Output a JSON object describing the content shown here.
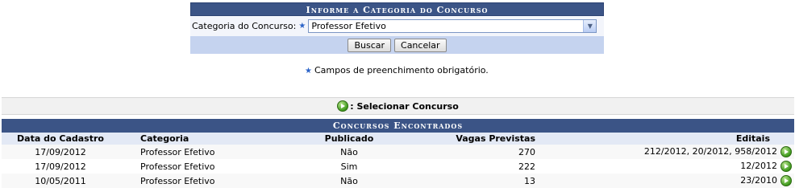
{
  "form": {
    "header": "Informe a Categoria do Concurso",
    "category_label": "Categoria do Concurso:",
    "category_value": "Professor Efetivo",
    "search_button": "Buscar",
    "cancel_button": "Cancelar"
  },
  "required_note": "Campos de preenchimento obrigatório.",
  "legend": {
    "icon": "go-arrow-icon",
    "label": ": Selecionar Concurso"
  },
  "results": {
    "caption": "Concursos Encontrados",
    "columns": [
      "Data do Cadastro",
      "Categoria",
      "Publicado",
      "Vagas Previstas",
      "Editais"
    ],
    "rows": [
      {
        "date": "17/09/2012",
        "category": "Professor Efetivo",
        "published": "Não",
        "vacancies": "270",
        "notices": "212/2012, 20/2012, 958/2012"
      },
      {
        "date": "17/09/2012",
        "category": "Professor Efetivo",
        "published": "Sim",
        "vacancies": "222",
        "notices": "12/2012"
      },
      {
        "date": "10/05/2011",
        "category": "Professor Efetivo",
        "published": "Não",
        "vacancies": "13",
        "notices": "23/2010"
      }
    ]
  },
  "colors": {
    "header_bg": "#3b5486",
    "form_footer_bg": "#c5d3ef",
    "required_star": "#2b63c8",
    "go_icon": "#3f9a1d"
  }
}
